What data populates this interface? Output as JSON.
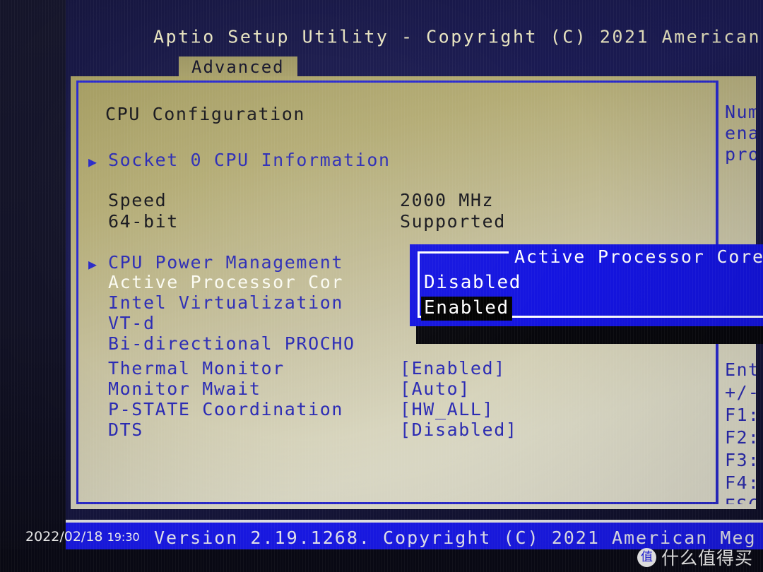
{
  "header": {
    "title": "Aptio Setup Utility - Copyright (C) 2021 American M",
    "tab": "Advanced"
  },
  "main": {
    "section_title": "CPU Configuration",
    "rows": [
      {
        "label": "Socket 0 CPU Information",
        "value": "",
        "arrow": true,
        "style": "normal"
      },
      {
        "label": "Speed",
        "value": "2000 MHz",
        "arrow": false,
        "style": "normal"
      },
      {
        "label": "64-bit",
        "value": "Supported",
        "arrow": false,
        "style": "normal"
      },
      {
        "label": "CPU Power Management",
        "value": "",
        "arrow": true,
        "style": "normal"
      },
      {
        "label": "Active Processor Cor",
        "value": "",
        "arrow": false,
        "style": "selected"
      },
      {
        "label": "Intel Virtualization",
        "value": "",
        "arrow": false,
        "style": "normal"
      },
      {
        "label": "VT-d",
        "value": "",
        "arrow": false,
        "style": "normal"
      },
      {
        "label": "Bi-directional PROCHO",
        "value": "",
        "arrow": false,
        "style": "normal"
      },
      {
        "label": "Thermal Monitor",
        "value": "[Enabled]",
        "arrow": false,
        "style": "normal"
      },
      {
        "label": "Monitor Mwait",
        "value": "[Auto]",
        "arrow": false,
        "style": "normal"
      },
      {
        "label": "P-STATE Coordination",
        "value": "[HW_ALL]",
        "arrow": false,
        "style": "normal"
      },
      {
        "label": "DTS",
        "value": "[Disabled]",
        "arrow": false,
        "style": "normal"
      }
    ]
  },
  "help": {
    "description_lines": [
      "Numb",
      "enab",
      "proc"
    ],
    "key_lines": [
      "Ente",
      "+/-:",
      "F1:",
      "F2:",
      "F3:",
      "F4:",
      "ESC"
    ]
  },
  "popup": {
    "title": "Active Processor Cores",
    "options": [
      "Disabled",
      "Enabled"
    ],
    "selected_index": 1
  },
  "footer": {
    "version": "Version 2.19.1268. Copyright (C) 2021 American Meg"
  },
  "overlay": {
    "date": "2022/02/18",
    "time": "19:30",
    "watermark_badge": "值",
    "watermark_text": "什么值得买"
  }
}
